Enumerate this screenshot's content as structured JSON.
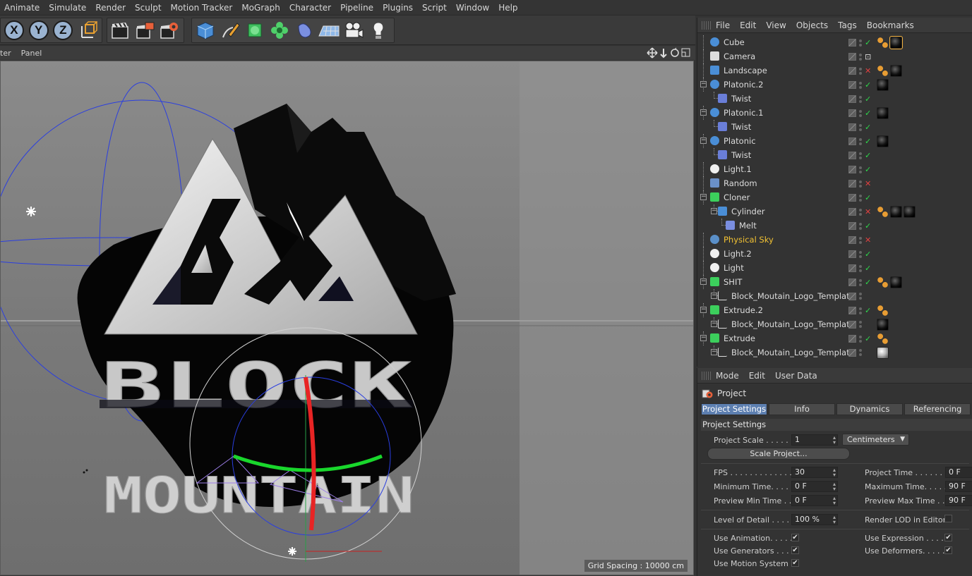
{
  "menubar": [
    "Animate",
    "Simulate",
    "Render",
    "Sculpt",
    "Motion Tracker",
    "MoGraph",
    "Character",
    "Pipeline",
    "Plugins",
    "Script",
    "Window",
    "Help"
  ],
  "toolbar": {
    "axis_x": "X",
    "axis_y": "Y",
    "axis_z": "Z",
    "icons": [
      "coordinate-system-icon",
      "render-view-icon",
      "render-picture-icon",
      "render-settings-icon",
      "cube-icon",
      "pen-icon",
      "subdivision-icon",
      "cloner-icon",
      "deformer-icon",
      "floor-icon",
      "camera-icon",
      "light-icon"
    ]
  },
  "viewport": {
    "menu": [
      "ter",
      "Panel"
    ],
    "grid_spacing": "Grid Spacing : 10000 cm",
    "logo_text": [
      "BM",
      "BLOCK",
      "MOUNTAIN"
    ]
  },
  "object_manager": {
    "menu": [
      "File",
      "Edit",
      "View",
      "Objects",
      "Tags",
      "Bookmarks"
    ],
    "objects": [
      {
        "name": "Cube",
        "indent": 0,
        "expand": false,
        "icon": "cube-icon",
        "check": "check",
        "tags": [
          "phong",
          "mat-sel"
        ]
      },
      {
        "name": "Camera",
        "indent": 0,
        "expand": false,
        "icon": "camera-icon",
        "check": "target",
        "tags": []
      },
      {
        "name": "Landscape",
        "indent": 0,
        "expand": false,
        "icon": "landscape-icon",
        "check": "x",
        "tags": [
          "phong",
          "mat"
        ]
      },
      {
        "name": "Platonic.2",
        "indent": 0,
        "expand": true,
        "icon": "platonic-icon",
        "check": "check",
        "tags": [
          "mat"
        ]
      },
      {
        "name": "Twist",
        "indent": 1,
        "expand": false,
        "icon": "twist-icon",
        "check": "check",
        "tags": []
      },
      {
        "name": "Platonic.1",
        "indent": 0,
        "expand": true,
        "icon": "platonic-icon",
        "check": "check",
        "tags": [
          "mat"
        ]
      },
      {
        "name": "Twist",
        "indent": 1,
        "expand": false,
        "icon": "twist-icon",
        "check": "check",
        "tags": []
      },
      {
        "name": "Platonic",
        "indent": 0,
        "expand": true,
        "icon": "platonic-icon",
        "check": "check",
        "tags": [
          "mat"
        ]
      },
      {
        "name": "Twist",
        "indent": 1,
        "expand": false,
        "icon": "twist-icon",
        "check": "check",
        "tags": []
      },
      {
        "name": "Light.1",
        "indent": 0,
        "expand": false,
        "icon": "light-icon",
        "check": "check",
        "tags": []
      },
      {
        "name": "Random",
        "indent": 0,
        "expand": false,
        "icon": "random-icon",
        "check": "x",
        "tags": []
      },
      {
        "name": "Cloner",
        "indent": 0,
        "expand": true,
        "icon": "cloner-icon",
        "check": "check",
        "tags": []
      },
      {
        "name": "Cylinder",
        "indent": 1,
        "expand": true,
        "icon": "cylinder-icon",
        "check": "x",
        "tags": [
          "phong",
          "mat",
          "mat"
        ]
      },
      {
        "name": "Melt",
        "indent": 2,
        "expand": false,
        "icon": "melt-icon",
        "check": "check",
        "tags": []
      },
      {
        "name": "Physical Sky",
        "indent": 0,
        "expand": false,
        "icon": "sky-icon",
        "check": "x",
        "tags": [],
        "highlight": true
      },
      {
        "name": "Light.2",
        "indent": 0,
        "expand": false,
        "icon": "light-icon",
        "check": "check",
        "tags": []
      },
      {
        "name": "Light",
        "indent": 0,
        "expand": false,
        "icon": "light-icon",
        "check": "check",
        "tags": []
      },
      {
        "name": "SHIT",
        "indent": 0,
        "expand": true,
        "icon": "extrude-icon",
        "check": "check",
        "tags": [
          "phong",
          "mat"
        ]
      },
      {
        "name": "Block_Moutain_Logo_Template",
        "indent": 1,
        "expand": true,
        "icon": "spline-icon",
        "check": "none",
        "tags": []
      },
      {
        "name": "Extrude.2",
        "indent": 0,
        "expand": true,
        "icon": "extrude-icon",
        "check": "check",
        "tags": [
          "phong"
        ]
      },
      {
        "name": "Block_Moutain_Logo_Template",
        "indent": 1,
        "expand": true,
        "icon": "spline-icon",
        "check": "none",
        "tags": [
          "mat"
        ]
      },
      {
        "name": "Extrude",
        "indent": 0,
        "expand": true,
        "icon": "extrude-icon",
        "check": "check",
        "tags": [
          "phong"
        ]
      },
      {
        "name": "Block_Moutain_Logo_Template",
        "indent": 1,
        "expand": true,
        "icon": "spline-icon",
        "check": "none",
        "tags": [
          "matw"
        ]
      }
    ]
  },
  "attribute_manager": {
    "menu": [
      "Mode",
      "Edit",
      "User Data"
    ],
    "title": "Project",
    "tabs": [
      "Project Settings",
      "Info",
      "Dynamics",
      "Referencing"
    ],
    "active_tab": 0,
    "section": "Project Settings",
    "project_scale_label": "Project Scale . . . . . .",
    "project_scale_value": "1",
    "project_scale_unit": "Centimeters",
    "scale_button": "Scale Project...",
    "fps_label": "FPS . . . . . . . . . . . . . . .",
    "fps_value": "30",
    "project_time_label": "Project Time . . . . . . . .",
    "project_time_value": "0 F",
    "min_time_label": "Minimum Time. . . . .",
    "min_time_value": "0 F",
    "max_time_label": "Maximum Time. . . . . .",
    "max_time_value": "90 F",
    "prev_min_label": "Preview Min Time . .",
    "prev_min_value": "0 F",
    "prev_max_label": "Preview Max Time . . .",
    "prev_max_value": "90 F",
    "lod_label": "Level of Detail . . . . .",
    "lod_value": "100 %",
    "render_lod_label": "Render LOD in Editor",
    "render_lod_checked": false,
    "use_animation_label": "Use Animation. . . . .",
    "use_animation": true,
    "use_expression_label": "Use Expression . . . . .",
    "use_expression": true,
    "use_generators_label": "Use Generators . . . .",
    "use_generators": true,
    "use_deformers_label": "Use Deformers. . . . . .",
    "use_deformers": true,
    "use_motion_label": "Use Motion System",
    "use_motion": true
  }
}
